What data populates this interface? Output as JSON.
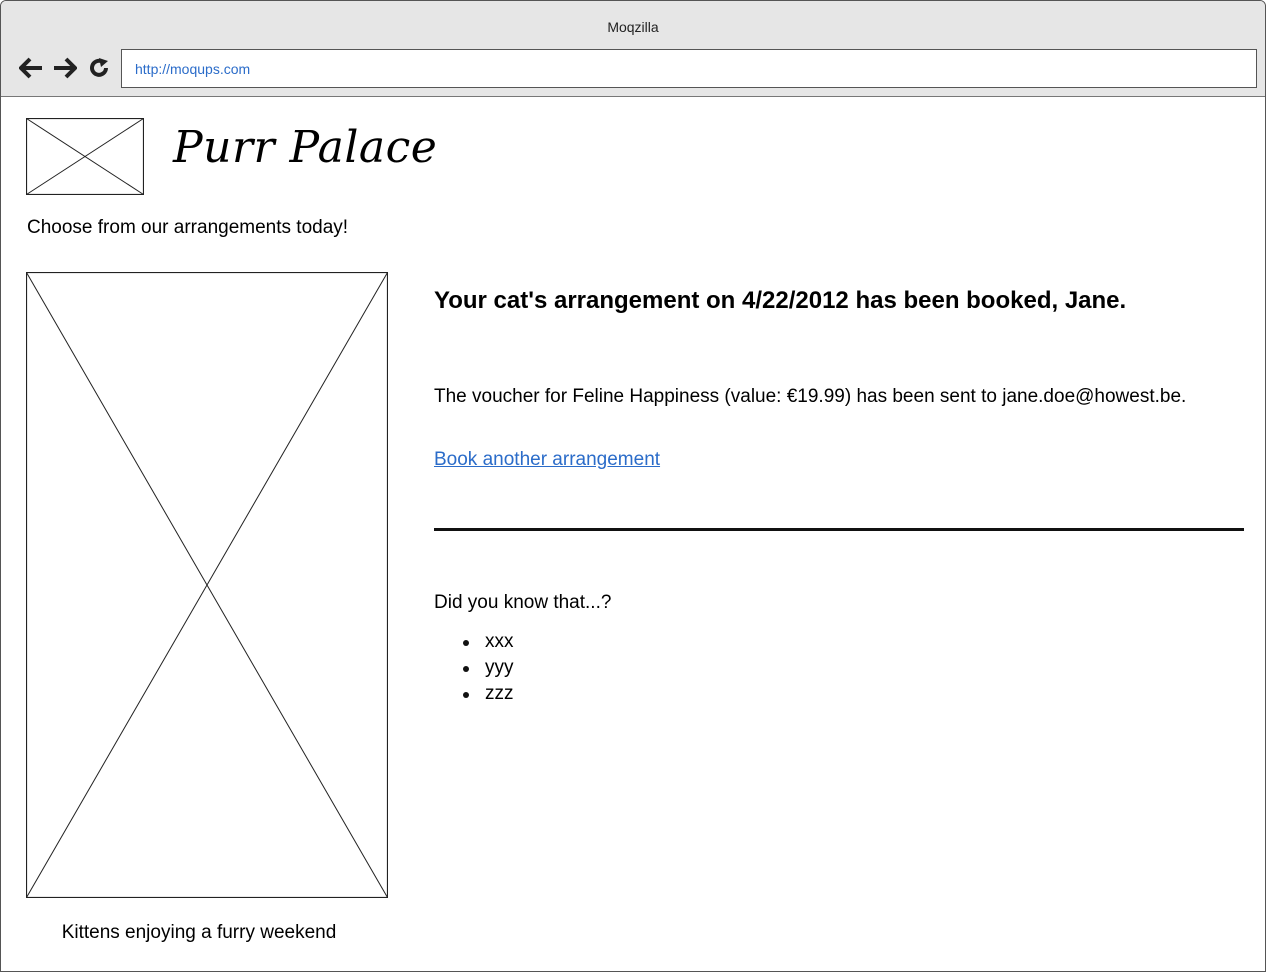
{
  "browser": {
    "title": "Moqzilla",
    "url": "http://moqups.com",
    "nav": {
      "back_icon": "arrow-left-icon",
      "forward_icon": "arrow-right-icon",
      "reload_icon": "reload-icon"
    }
  },
  "site": {
    "brand": "Purr Palace",
    "tagline": "Choose from our arrangements today!",
    "hero_caption": "Kittens enjoying a furry weekend"
  },
  "confirmation": {
    "heading": "Your cat's arrangement on 4/22/2012 has been booked, Jane.",
    "voucher_text": "The voucher for Feline Happiness (value: €19.99) has been sent to jane.doe@howest.be.",
    "book_link": "Book another arrangement"
  },
  "facts": {
    "title": "Did you know that...?",
    "items": [
      "xxx",
      "yyy",
      "zzz"
    ]
  },
  "colors": {
    "link": "#2b6cc9",
    "chrome": "#e6e6e6"
  }
}
